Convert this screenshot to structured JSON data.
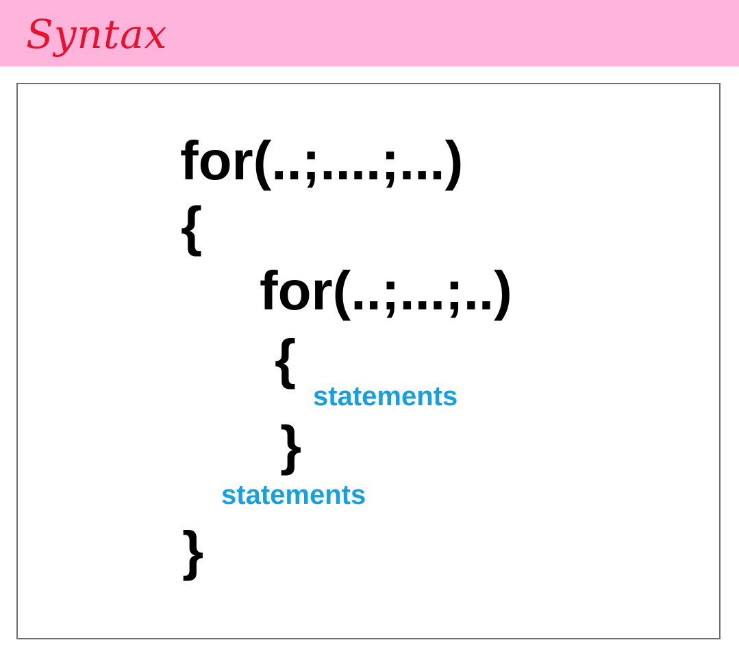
{
  "header": {
    "title": "Syntax",
    "background_color": "#ffb4dc",
    "title_color": "#e8112d"
  },
  "code": {
    "text_color": "#000000",
    "statement_color": "#17a0e0",
    "outer_for": "for(..;....;...)",
    "outer_open_brace": "{",
    "inner_for": "for(..;...;..)",
    "inner_open_brace": "{",
    "inner_statements": "statements",
    "inner_close_brace": "}",
    "outer_statements": "statements",
    "outer_close_brace": "}"
  }
}
